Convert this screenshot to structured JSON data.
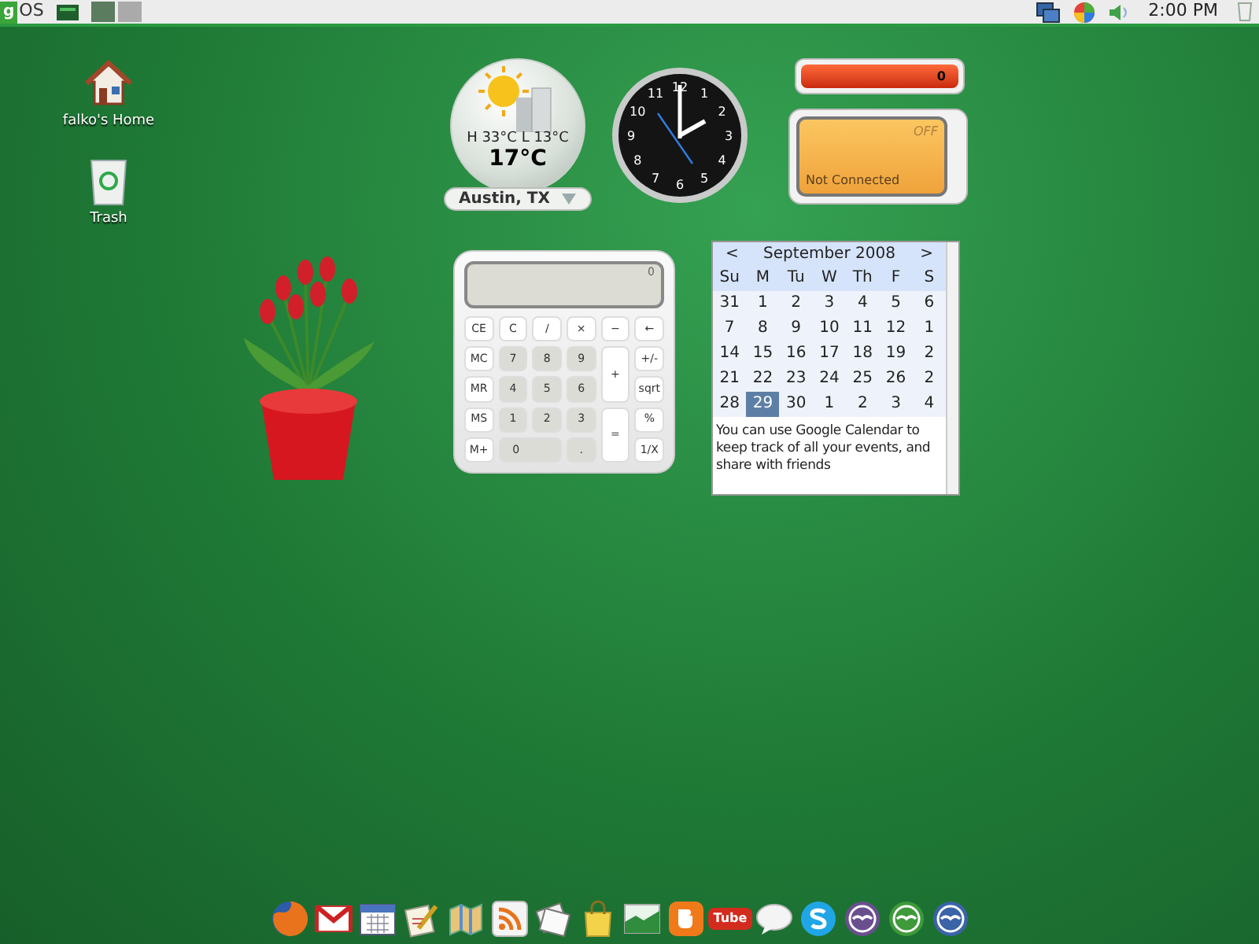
{
  "top_bar": {
    "menu": {
      "badge": "g",
      "label": "OS"
    },
    "workspaces": [
      {
        "selected": true
      },
      {
        "selected": false
      }
    ],
    "clock": "2:00 PM"
  },
  "desktop_icons": [
    {
      "kind": "home",
      "label": "falko's Home"
    },
    {
      "kind": "trash",
      "label": "Trash"
    }
  ],
  "weather": {
    "high": "H 33°C",
    "low": "L 13°C",
    "temperature": "17°C",
    "location": "Austin, TX"
  },
  "clock": {
    "numbers": [
      "12",
      "11",
      "1",
      "10",
      "2",
      "9",
      "3",
      "8",
      "4",
      "7",
      "5",
      "6"
    ]
  },
  "meter": {
    "reading": "0"
  },
  "wifi": {
    "power": "OFF",
    "status": "Not Connected"
  },
  "calculator": {
    "display": "0",
    "keys": [
      {
        "label": "CE",
        "kind": "fn"
      },
      {
        "label": "C",
        "kind": "fn"
      },
      {
        "label": "/",
        "kind": "fn"
      },
      {
        "label": "×",
        "kind": "fn"
      },
      {
        "label": "−",
        "kind": "fn"
      },
      {
        "label": "←",
        "kind": "fn"
      },
      {
        "label": "MC",
        "kind": "fn"
      },
      {
        "label": "7",
        "kind": "digit"
      },
      {
        "label": "8",
        "kind": "digit"
      },
      {
        "label": "9",
        "kind": "digit"
      },
      {
        "label": "+",
        "kind": "tall"
      },
      {
        "label": "+/-",
        "kind": "fn"
      },
      {
        "label": "MR",
        "kind": "fn"
      },
      {
        "label": "4",
        "kind": "digit"
      },
      {
        "label": "5",
        "kind": "digit"
      },
      {
        "label": "6",
        "kind": "digit"
      },
      {
        "label": "sqrt",
        "kind": "fn"
      },
      {
        "label": "MS",
        "kind": "fn"
      },
      {
        "label": "1",
        "kind": "digit"
      },
      {
        "label": "2",
        "kind": "digit"
      },
      {
        "label": "3",
        "kind": "digit"
      },
      {
        "label": "=",
        "kind": "tall"
      },
      {
        "label": "%",
        "kind": "fn"
      },
      {
        "label": "M+",
        "kind": "fn"
      },
      {
        "label": "0",
        "kind": "wide"
      },
      {
        "label": ".",
        "kind": "digit"
      },
      {
        "label": "1/X",
        "kind": "fn"
      }
    ]
  },
  "calendar": {
    "prev": "<",
    "month": "September 2008",
    "next": ">",
    "weekdays": [
      "Su",
      "M",
      "Tu",
      "W",
      "Th",
      "F",
      "S"
    ],
    "weeks": [
      [
        {
          "day": "31",
          "selected": false
        },
        {
          "day": "1",
          "selected": false
        },
        {
          "day": "2",
          "selected": false
        },
        {
          "day": "3",
          "selected": false
        },
        {
          "day": "4",
          "selected": false
        },
        {
          "day": "5",
          "selected": false
        },
        {
          "day": "6",
          "selected": false
        }
      ],
      [
        {
          "day": "7",
          "selected": false
        },
        {
          "day": "8",
          "selected": false
        },
        {
          "day": "9",
          "selected": false
        },
        {
          "day": "10",
          "selected": false
        },
        {
          "day": "11",
          "selected": false
        },
        {
          "day": "12",
          "selected": false
        },
        {
          "day": "1",
          "selected": false
        }
      ],
      [
        {
          "day": "14",
          "selected": false
        },
        {
          "day": "15",
          "selected": false
        },
        {
          "day": "16",
          "selected": false
        },
        {
          "day": "17",
          "selected": false
        },
        {
          "day": "18",
          "selected": false
        },
        {
          "day": "19",
          "selected": false
        },
        {
          "day": "2",
          "selected": false
        }
      ],
      [
        {
          "day": "21",
          "selected": false
        },
        {
          "day": "22",
          "selected": false
        },
        {
          "day": "23",
          "selected": false
        },
        {
          "day": "24",
          "selected": false
        },
        {
          "day": "25",
          "selected": false
        },
        {
          "day": "26",
          "selected": false
        },
        {
          "day": "2",
          "selected": false
        }
      ],
      [
        {
          "day": "28",
          "selected": false
        },
        {
          "day": "29",
          "selected": true
        },
        {
          "day": "30",
          "selected": false
        },
        {
          "day": "1",
          "selected": false
        },
        {
          "day": "2",
          "selected": false
        },
        {
          "day": "3",
          "selected": false
        },
        {
          "day": "4",
          "selected": false
        }
      ]
    ],
    "note": "You can use Google Calendar to keep track of all your events, and share with friends"
  },
  "dock": [
    {
      "kind": "browser"
    },
    {
      "kind": "mail"
    },
    {
      "kind": "calendar"
    },
    {
      "kind": "notes"
    },
    {
      "kind": "map"
    },
    {
      "kind": "feed"
    },
    {
      "kind": "news"
    },
    {
      "kind": "bag"
    },
    {
      "kind": "photo"
    },
    {
      "kind": "blog"
    },
    {
      "kind": "video",
      "label": "Tube"
    },
    {
      "kind": "chat"
    },
    {
      "kind": "phone"
    },
    {
      "kind": "office",
      "color": "#6a4f8f"
    },
    {
      "kind": "office",
      "color": "#3f9a3a"
    },
    {
      "kind": "office",
      "color": "#3a63a8"
    }
  ]
}
